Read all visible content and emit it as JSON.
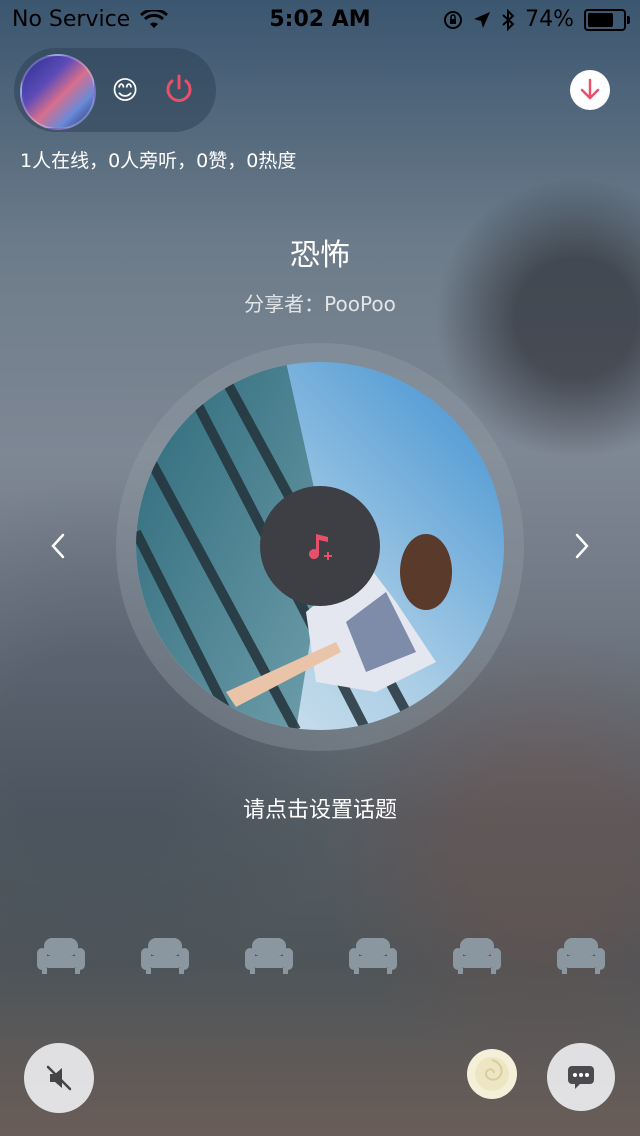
{
  "status_bar": {
    "carrier": "No Service",
    "time": "5:02 AM",
    "battery_percent": "74%",
    "battery_level": 0.74,
    "icons": [
      "wifi-icon",
      "orientation-lock-icon",
      "location-icon",
      "bluetooth-icon",
      "battery-icon"
    ]
  },
  "header": {
    "emoji": "😊",
    "icons": [
      "avatar",
      "smile-icon",
      "power-icon",
      "download-icon"
    ],
    "stats": "1人在线，0人旁听，0赞，0热度"
  },
  "room": {
    "title": "恐怖",
    "sharer": "分享者：PooPoo",
    "topic_prompt": "请点击设置话题",
    "center_icon": "music-add-icon",
    "nav_icons": [
      "chevron-left-icon",
      "chevron-right-icon"
    ]
  },
  "seats": {
    "count": 6,
    "icon": "sofa-icon"
  },
  "bottom": {
    "icons": [
      "mute-icon",
      "flower-icon",
      "chat-icon"
    ]
  },
  "colors": {
    "accent": "#e8506a",
    "status_text": "#000000",
    "seat": "#8a96a0",
    "disc_center": "#3e3f44"
  }
}
